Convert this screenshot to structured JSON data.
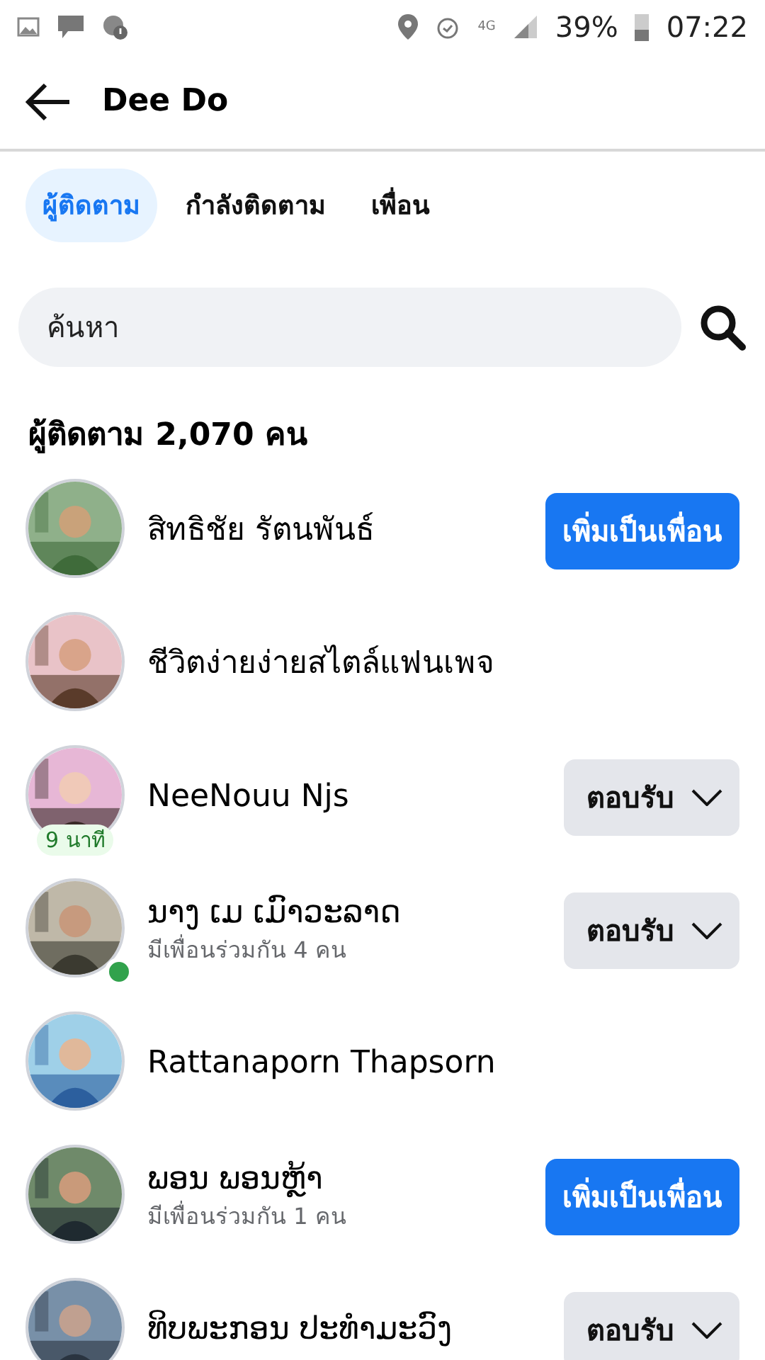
{
  "status_bar": {
    "network": "4G",
    "battery": "39%",
    "time": "07:22"
  },
  "header": {
    "title": "Dee Do"
  },
  "tabs": [
    {
      "label": "ผู้ติดตาม",
      "selected": true
    },
    {
      "label": "กำลังติดตาม",
      "selected": false
    },
    {
      "label": "เพื่อน",
      "selected": false
    }
  ],
  "search": {
    "placeholder": "ค้นหา"
  },
  "section_title": "ผู้ติดตาม 2,070 คน",
  "people": [
    {
      "name": "สิทธิชัย รัตนพันธ์",
      "action": {
        "kind": "add",
        "label": "เพิ่มเป็นเพื่อน"
      },
      "online": false
    },
    {
      "name": "ชีวิตง่ายง่ายสไตล์แฟนเพจ",
      "online": false
    },
    {
      "name": "NeeNouu Njs",
      "badge": "9 นาที",
      "action": {
        "kind": "respond",
        "label": "ตอบรับ"
      },
      "online": false
    },
    {
      "name": "ນາງ ເມ ເມົາວະລາດ",
      "subtitle": "มีเพื่อนร่วมกัน 4 คน",
      "action": {
        "kind": "respond",
        "label": "ตอบรับ"
      },
      "online": true
    },
    {
      "name": "Rattanaporn Thapsorn",
      "online": false
    },
    {
      "name": "ພອນ ພອນຫຼ້າ",
      "subtitle": "มีเพื่อนร่วมกัน 1 คน",
      "action": {
        "kind": "add",
        "label": "เพิ่มเป็นเพื่อน"
      },
      "online": false
    },
    {
      "name": "ທິບພະກອນ ປະທຳມະວົງ",
      "action": {
        "kind": "respond",
        "label": "ตอบรับ"
      },
      "online": false
    }
  ]
}
